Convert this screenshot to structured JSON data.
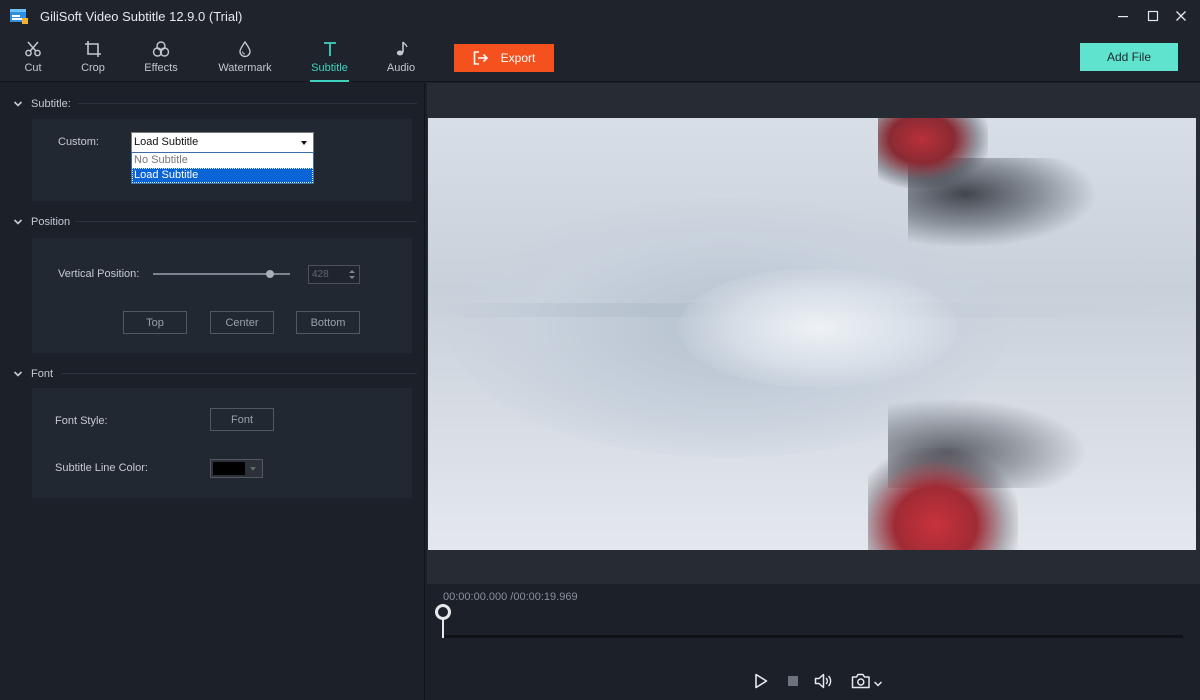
{
  "window": {
    "title": "GiliSoft Video Subtitle 12.9.0 (Trial)"
  },
  "toolbar": {
    "tools": [
      {
        "label": "Cut",
        "icon": "scissors-icon"
      },
      {
        "label": "Crop",
        "icon": "crop-icon"
      },
      {
        "label": "Effects",
        "icon": "effects-icon"
      },
      {
        "label": "Watermark",
        "icon": "droplet-icon"
      },
      {
        "label": "Subtitle",
        "icon": "text-t-icon",
        "active": true
      },
      {
        "label": "Audio",
        "icon": "music-note-icon"
      }
    ],
    "export_label": "Export",
    "add_file_label": "Add File"
  },
  "subtitle_section": {
    "title": "Subtitle:",
    "custom_label": "Custom:",
    "selected": "Load Subtitle",
    "options": [
      "No Subtitle",
      "Load Subtitle"
    ]
  },
  "position_section": {
    "title": "Position",
    "vertical_label": "Vertical Position:",
    "vertical_value": "428",
    "buttons": [
      "Top",
      "Center",
      "Bottom"
    ]
  },
  "font_section": {
    "title": "Font",
    "font_style_label": "Font Style:",
    "font_button": "Font",
    "line_color_label": "Subtitle Line Color:",
    "line_color": "#000000"
  },
  "player": {
    "current_time": "00:00:00.000",
    "total_time": "00:00:19.969",
    "time_display": "00:00:00.000 /00:00:19.969",
    "progress": 0
  },
  "colors": {
    "accent": "#3fd1c0",
    "export": "#f4511e",
    "add_file": "#5fe3cf",
    "background": "#1b2029"
  }
}
